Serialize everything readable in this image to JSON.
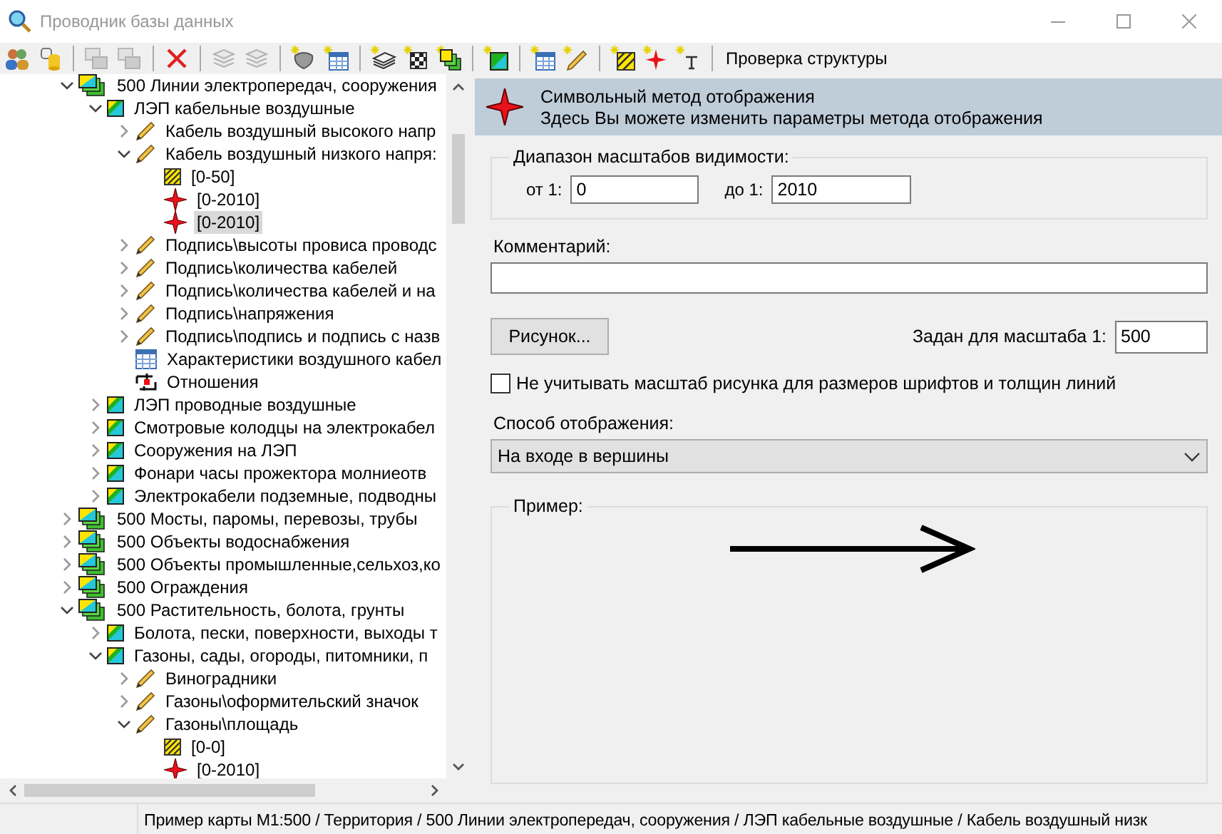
{
  "window": {
    "title": "Проводник базы данных",
    "active": false
  },
  "toolbar": {
    "items": [
      {
        "kind": "people",
        "disabled": false
      },
      {
        "kind": "database",
        "disabled": false
      },
      {
        "kind": "separator"
      },
      {
        "kind": "layers",
        "disabled": true
      },
      {
        "kind": "layers",
        "disabled": true
      },
      {
        "kind": "separator"
      },
      {
        "kind": "delete",
        "disabled": false
      },
      {
        "kind": "separator"
      },
      {
        "kind": "stack",
        "disabled": true
      },
      {
        "kind": "stack",
        "disabled": true
      },
      {
        "kind": "separator"
      },
      {
        "kind": "shape",
        "disabled": false
      },
      {
        "kind": "table-new",
        "disabled": false
      },
      {
        "kind": "separator"
      },
      {
        "kind": "book",
        "disabled": false
      },
      {
        "kind": "checker",
        "disabled": false
      },
      {
        "kind": "group",
        "disabled": false
      },
      {
        "kind": "separator"
      },
      {
        "kind": "layer-new",
        "disabled": false
      },
      {
        "kind": "separator"
      },
      {
        "kind": "table-new",
        "disabled": false
      },
      {
        "kind": "pencil-new",
        "disabled": false
      },
      {
        "kind": "separator"
      },
      {
        "kind": "hatch-new",
        "disabled": false
      },
      {
        "kind": "star-new",
        "disabled": false
      },
      {
        "kind": "text-new",
        "disabled": false
      },
      {
        "kind": "separator"
      },
      {
        "kind": "text",
        "label": "Проверка структуры"
      }
    ]
  },
  "tree": [
    {
      "label": "500 Линии электропередач, сооружения",
      "kind": "group",
      "expanded": true,
      "selected": false,
      "children": [
        {
          "label": "ЛЭП кабельные воздушные",
          "kind": "layer",
          "expanded": true,
          "selected": false,
          "children": [
            {
              "label": "Кабель воздушный высокого напр",
              "kind": "pencil",
              "expanded": false,
              "selected": false
            },
            {
              "label": "Кабель воздушный низкого напря:",
              "kind": "pencil",
              "expanded": true,
              "selected": false,
              "children": [
                {
                  "label": "[0-50]",
                  "kind": "hatch",
                  "selected": false
                },
                {
                  "label": "[0-2010]",
                  "kind": "star",
                  "selected": false
                },
                {
                  "label": "[0-2010]",
                  "kind": "star",
                  "selected": true
                }
              ]
            },
            {
              "label": "Подпись\\высоты провиса проводс",
              "kind": "pencil",
              "expanded": false,
              "selected": false
            },
            {
              "label": "Подпись\\количества кабелей",
              "kind": "pencil",
              "expanded": false,
              "selected": false
            },
            {
              "label": "Подпись\\количества кабелей и на",
              "kind": "pencil",
              "expanded": false,
              "selected": false
            },
            {
              "label": "Подпись\\напряжения",
              "kind": "pencil",
              "expanded": false,
              "selected": false
            },
            {
              "label": "Подпись\\подпись и подпись с назв",
              "kind": "pencil",
              "expanded": false,
              "selected": false
            },
            {
              "label": "Характеристики воздушного кабел",
              "kind": "table",
              "selected": false
            },
            {
              "label": "Отношения",
              "kind": "relations",
              "selected": false
            }
          ]
        },
        {
          "label": "ЛЭП проводные воздушные",
          "kind": "layer",
          "expanded": false,
          "selected": false
        },
        {
          "label": "Смотровые колодцы на электрокабел",
          "kind": "layer",
          "expanded": false,
          "selected": false
        },
        {
          "label": "Сооружения на ЛЭП",
          "kind": "layer",
          "expanded": false,
          "selected": false
        },
        {
          "label": "Фонари часы прожектора молниеотв",
          "kind": "layer",
          "expanded": false,
          "selected": false
        },
        {
          "label": "Электрокабели подземные, подводны",
          "kind": "layer",
          "expanded": false,
          "selected": false
        }
      ]
    },
    {
      "label": "500 Мосты, паромы, перевозы, трубы",
      "kind": "group",
      "expanded": false,
      "selected": false
    },
    {
      "label": "500 Объекты водоснабжения",
      "kind": "group",
      "expanded": false,
      "selected": false
    },
    {
      "label": "500 Объекты промышленные,сельхоз,ко",
      "kind": "group",
      "expanded": false,
      "selected": false
    },
    {
      "label": "500 Ограждения",
      "kind": "group",
      "expanded": false,
      "selected": false
    },
    {
      "label": "500 Растительность, болота, грунты",
      "kind": "group",
      "expanded": true,
      "selected": false,
      "children": [
        {
          "label": "Болота, пески, поверхности, выходы т",
          "kind": "layer",
          "expanded": false,
          "selected": false
        },
        {
          "label": "Газоны, сады, огороды, питомники, п",
          "kind": "layer",
          "expanded": true,
          "selected": false,
          "children": [
            {
              "label": "Виноградники",
              "kind": "pencil",
              "expanded": false,
              "selected": false
            },
            {
              "label": "Газоны\\оформительский значок",
              "kind": "pencil",
              "expanded": false,
              "selected": false
            },
            {
              "label": "Газоны\\площадь",
              "kind": "pencil",
              "expanded": true,
              "selected": false,
              "children": [
                {
                  "label": "[0-0]",
                  "kind": "hatch",
                  "selected": false
                },
                {
                  "label": "[0-2010]",
                  "kind": "star",
                  "selected": false
                }
              ]
            }
          ]
        }
      ]
    }
  ],
  "panel": {
    "header": {
      "title": "Символьный метод отображения",
      "subtitle": "Здесь Вы можете изменить параметры метода отображения"
    },
    "scale_range": {
      "title": "Диапазон масштабов видимости:",
      "from_label": "от 1:",
      "from_value": "0",
      "to_label": "до 1:",
      "to_value": "2010"
    },
    "comment": {
      "label": "Комментарий:"
    },
    "picture_button": "Рисунок...",
    "scale": {
      "label": "Задан для масштаба 1:",
      "value": "500"
    },
    "ignore_scale": {
      "label": "Не учитывать масштаб рисунка для размеров шрифтов и толщин линий",
      "checked": false
    },
    "display_mode": {
      "label": "Способ отображения:",
      "value": "На входе в вершины"
    },
    "example": {
      "title": "Пример:"
    }
  },
  "status_bar": {
    "text": "Пример карты М1:500 / Территория / 500 Линии электропередач, сооружения / ЛЭП кабельные воздушные / Кабель воздушный низк"
  }
}
